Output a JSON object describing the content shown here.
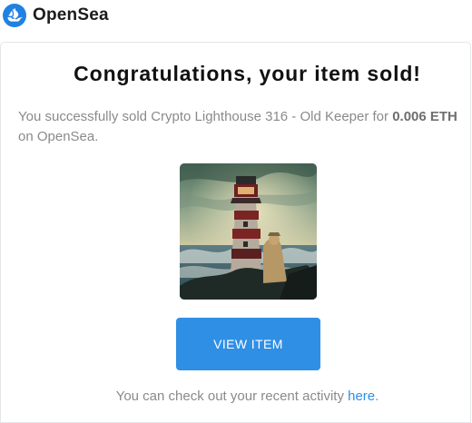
{
  "brand": {
    "name": "OpenSea",
    "accent_color": "#2081e2"
  },
  "email": {
    "headline": "Congratulations, your item sold!",
    "message_prefix": "You successfully sold Crypto Lighthouse 316 - Old Keeper for ",
    "price": "0.006 ETH",
    "message_suffix": " on OpenSea.",
    "image_icon": "lighthouse-artwork",
    "button_label": "VIEW ITEM",
    "button_color": "#2f8fe5",
    "footer_prefix": "You can check out your recent activity ",
    "footer_link": "here",
    "footer_suffix": "."
  }
}
